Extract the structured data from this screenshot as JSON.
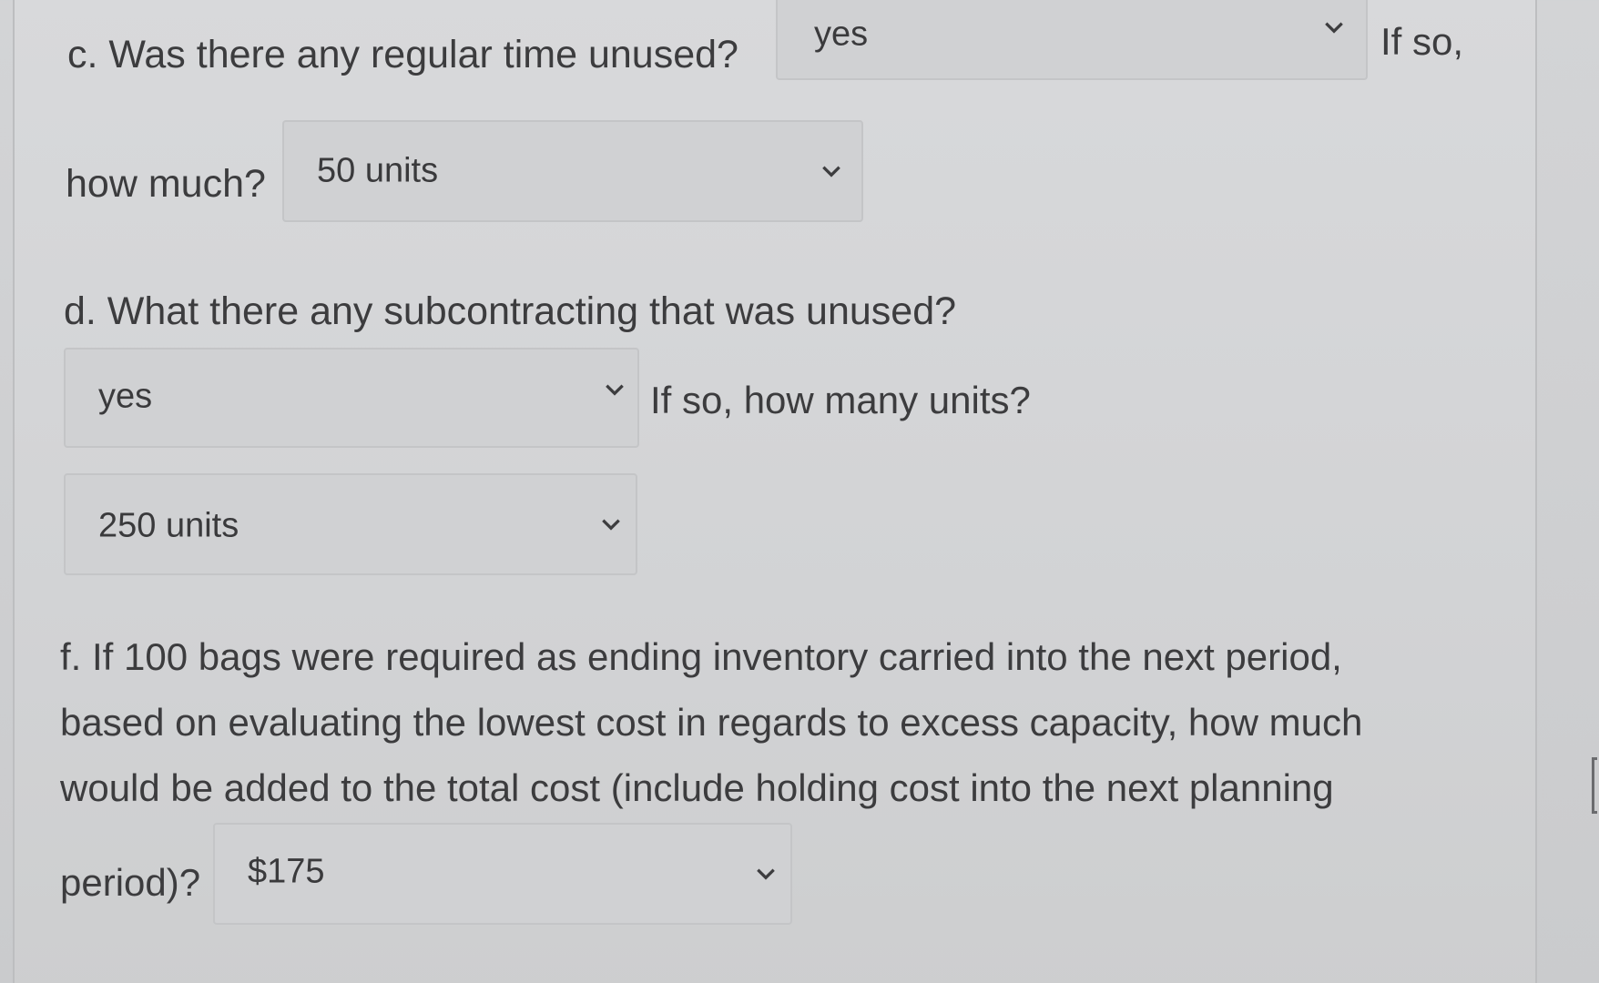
{
  "part_c": {
    "question": "c. Was there any regular time unused?",
    "select_value": "yes",
    "suffix": "If so,",
    "continuation": "how much?",
    "amount_value": "50 units"
  },
  "part_d": {
    "question": "d. What there any subcontracting that was unused?",
    "select_value": "yes",
    "suffix": "If so, how many units?",
    "amount_value": "250 units"
  },
  "part_f": {
    "line1": "f. If 100 bags were required as ending inventory carried into the next period,",
    "line2": "based on evaluating the lowest cost in regards to excess capacity, how much",
    "line3": "would be added to the total cost (include holding cost into the next planning",
    "line4": "period)?",
    "select_value": "$175"
  },
  "icons": {
    "dropdown": "chevron-down-icon"
  }
}
